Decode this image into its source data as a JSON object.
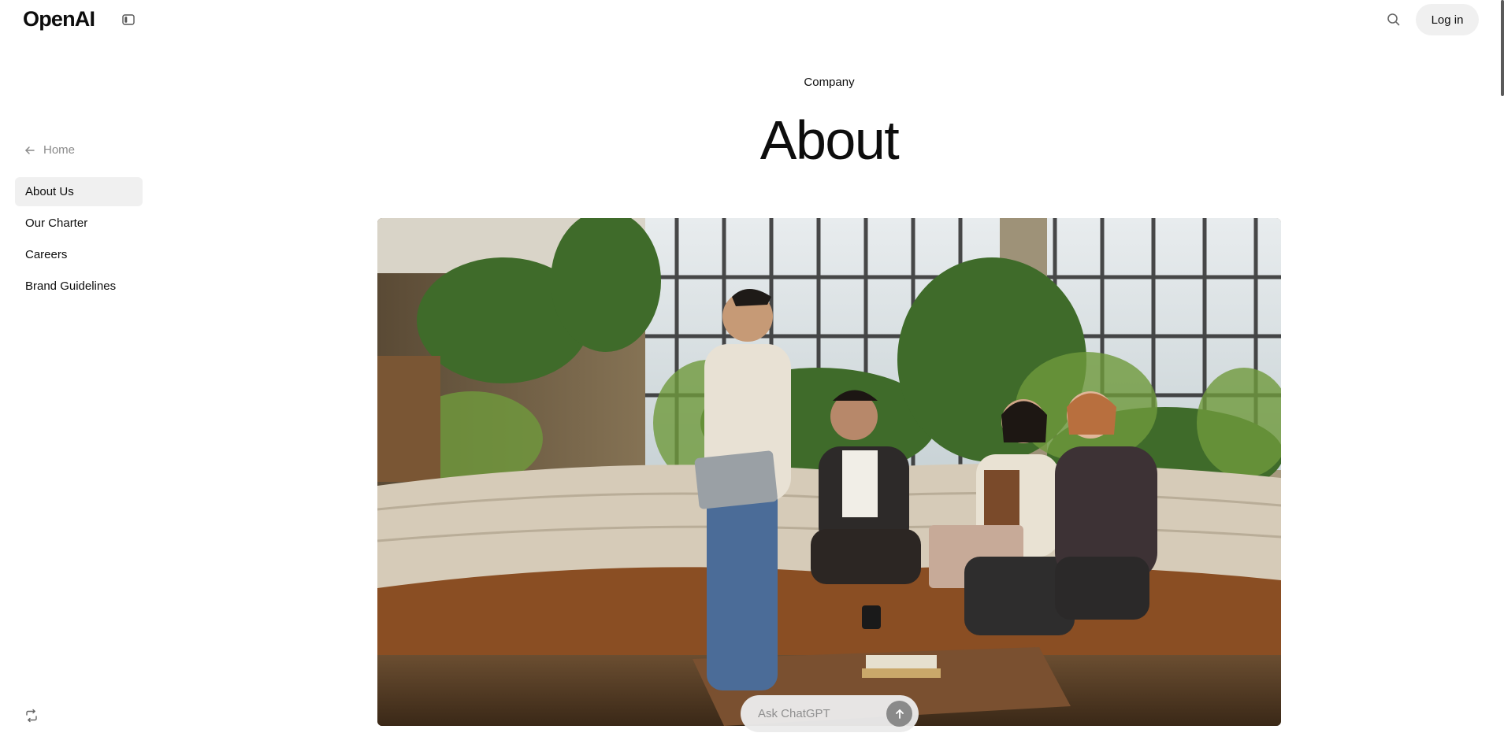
{
  "header": {
    "logo": "OpenAI",
    "login_label": "Log in"
  },
  "sidebar": {
    "home_label": "Home",
    "items": [
      {
        "label": "About Us",
        "active": true
      },
      {
        "label": "Our Charter",
        "active": false
      },
      {
        "label": "Careers",
        "active": false
      },
      {
        "label": "Brand Guidelines",
        "active": false
      }
    ]
  },
  "main": {
    "kicker": "Company",
    "title": "About"
  },
  "ask": {
    "placeholder": "Ask ChatGPT"
  },
  "icons": {
    "sidebar_toggle": "sidebar-panel-icon",
    "search": "search-icon",
    "home_arrow": "arrow-left-icon",
    "send": "arrow-up-icon",
    "bottom": "swap-icon"
  },
  "colors": {
    "active_nav_bg": "#f0f0f0",
    "login_bg": "#f0f0f0",
    "send_bg": "#8a8a8a"
  }
}
